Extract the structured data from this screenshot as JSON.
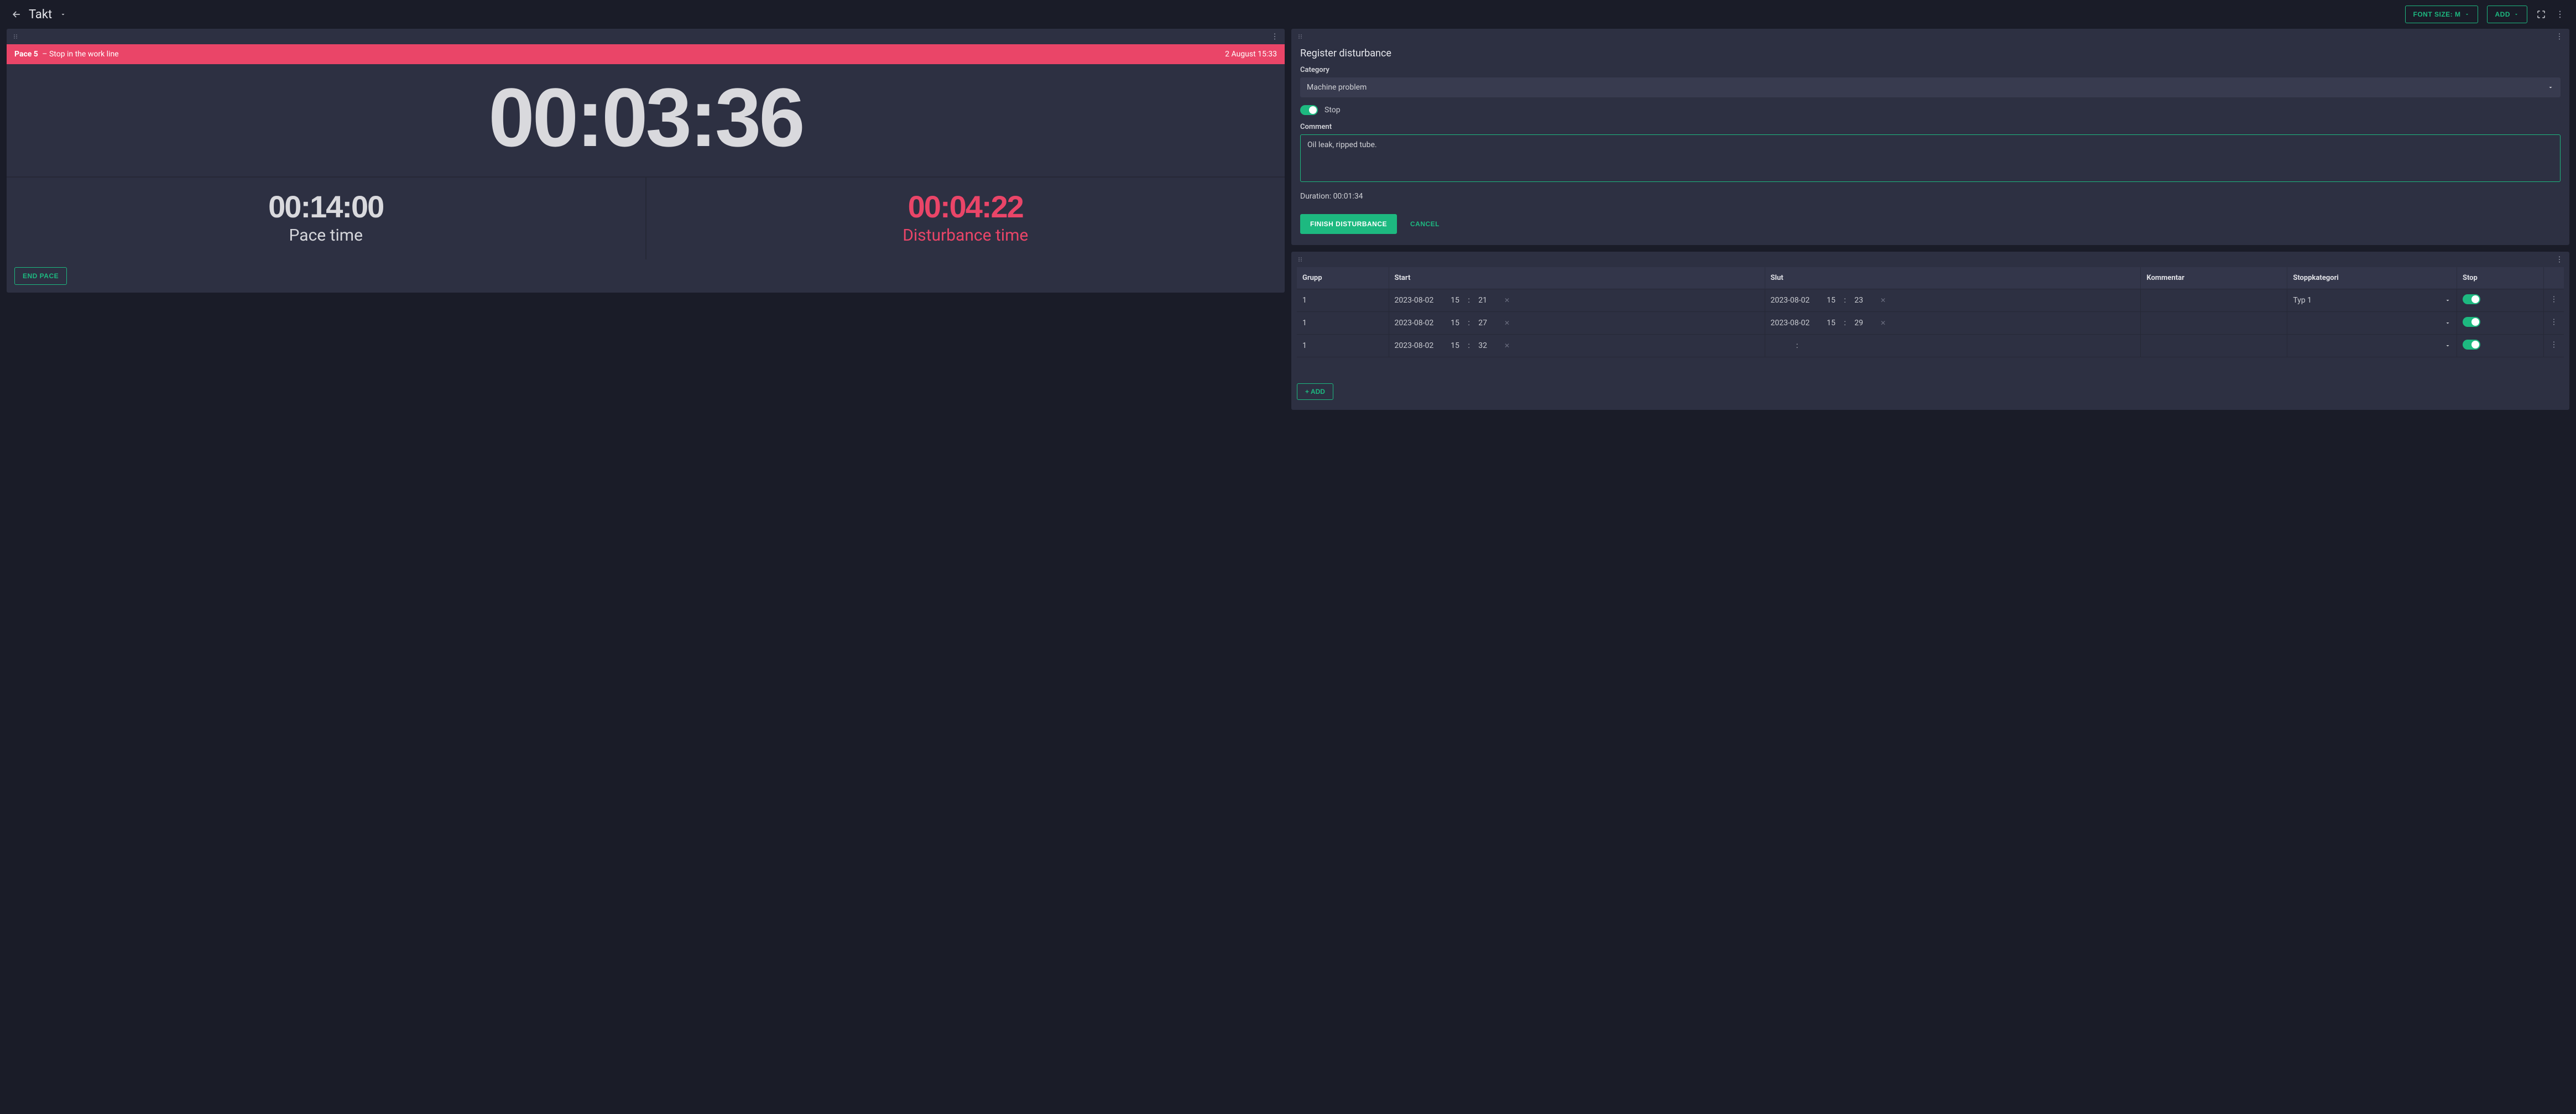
{
  "header": {
    "title": "Takt",
    "font_size_btn": "FONT SIZE: M",
    "add_btn": "ADD"
  },
  "alert": {
    "pace": "Pace 5",
    "message": "Stop in the work line",
    "timestamp": "2 August 15:33"
  },
  "clock": {
    "main": "00:03:36",
    "pace_value": "00:14:00",
    "pace_label": "Pace time",
    "disturb_value": "00:04:22",
    "disturb_label": "Disturbance time",
    "end_pace_btn": "END PACE"
  },
  "form": {
    "title": "Register disturbance",
    "category_label": "Category",
    "category_value": "Machine problem",
    "stop_toggle_label": "Stop",
    "comment_label": "Comment",
    "comment_value": "Oil leak, ripped tube.",
    "duration_prefix": "Duration: ",
    "duration_value": "00:01:34",
    "finish_btn": "FINISH DISTURBANCE",
    "cancel_btn": "CANCEL"
  },
  "table": {
    "headers": {
      "group": "Grupp",
      "start": "Start",
      "end": "Slut",
      "comment": "Kommentar",
      "stopcat": "Stoppkategori",
      "stop": "Stop"
    },
    "rows": [
      {
        "group": "1",
        "start_date": "2023-08-02",
        "start_h": "15",
        "start_m": "21",
        "end_date": "2023-08-02",
        "end_h": "15",
        "end_m": "23",
        "comment": "",
        "cat": "Typ 1",
        "stop": true
      },
      {
        "group": "1",
        "start_date": "2023-08-02",
        "start_h": "15",
        "start_m": "27",
        "end_date": "2023-08-02",
        "end_h": "15",
        "end_m": "29",
        "comment": "",
        "cat": "",
        "stop": true
      },
      {
        "group": "1",
        "start_date": "2023-08-02",
        "start_h": "15",
        "start_m": "32",
        "end_date": "",
        "end_h": "",
        "end_m": "",
        "comment": "",
        "cat": "",
        "stop": true
      }
    ],
    "add_btn": "+ ADD"
  }
}
